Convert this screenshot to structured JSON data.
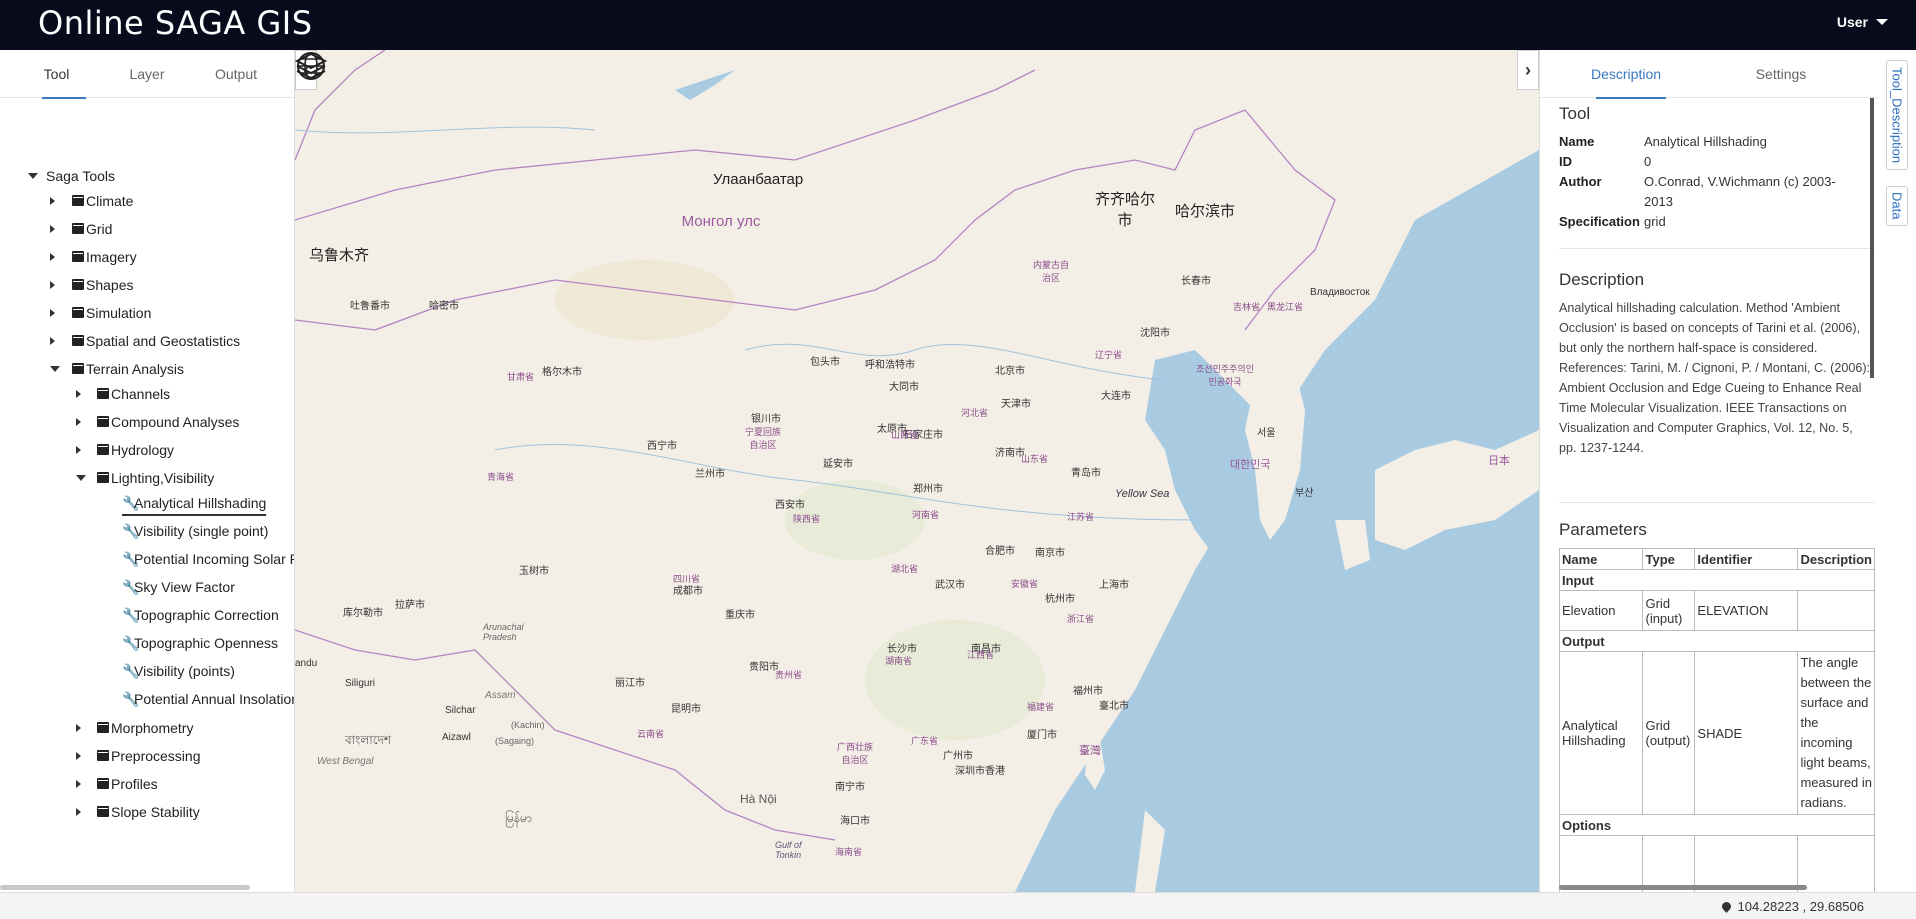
{
  "app": {
    "title": "Online SAGA GIS",
    "user_label": "User"
  },
  "left_panel": {
    "tabs": [
      {
        "label": "Tool"
      },
      {
        "label": "Layer"
      },
      {
        "label": "Output"
      }
    ],
    "tree": {
      "root": "Saga Tools",
      "categories": [
        {
          "label": "Climate"
        },
        {
          "label": "Grid"
        },
        {
          "label": "Imagery"
        },
        {
          "label": "Shapes"
        },
        {
          "label": "Simulation"
        },
        {
          "label": "Spatial and Geostatistics"
        },
        {
          "label": "Terrain Analysis"
        }
      ],
      "terrain_children": [
        {
          "label": "Channels"
        },
        {
          "label": "Compound Analyses"
        },
        {
          "label": "Hydrology"
        },
        {
          "label": "Lighting,Visibility"
        },
        {
          "label": "Morphometry"
        },
        {
          "label": "Preprocessing"
        },
        {
          "label": "Profiles"
        },
        {
          "label": "Slope Stability"
        }
      ],
      "lighting_tools": [
        {
          "label": "Analytical Hillshading"
        },
        {
          "label": "Visibility (single point)"
        },
        {
          "label": "Potential Incoming Solar Radiation"
        },
        {
          "label": "Sky View Factor"
        },
        {
          "label": "Topographic Correction"
        },
        {
          "label": "Topographic Openness"
        },
        {
          "label": "Visibility (points)"
        },
        {
          "label": "Potential Annual Insolation"
        }
      ]
    }
  },
  "map": {
    "labels": {
      "ulaanbaatar": "Улаанбаатар",
      "mongolia": "Монгол улс",
      "urumqi": "乌鲁木齐",
      "qiqihar": "齐齐哈尔市",
      "harbin": "哈尔滨市",
      "yellow_sea": "Yellow Sea",
      "south_korea": "대한민국",
      "north_korea": "조선민주주의인민공화국",
      "japan": "日本",
      "taiwan": "臺灣",
      "arunachal": "Arunachal Pradesh",
      "kachin": "(Kachin)",
      "sagaing": "(Sagaing)",
      "bangladesh": "বাংলাদেশ",
      "myanmar": "မြန်မာ",
      "hanoi": "Hà Nội",
      "hainan": "海南省",
      "gulf_tonkin": "Gulf of Tonkin",
      "beijing": "北京市",
      "tianjin": "天津市",
      "shanghai": "上海市",
      "wuhan": "武汉市",
      "chongqing": "重庆市",
      "chengdu": "成都市",
      "xian": "西安市",
      "guangzhou": "广州市",
      "nanning": "南宁市",
      "kunming": "昆明市",
      "guiyang": "贵阳市",
      "changsha": "长沙市",
      "nanchang": "南昌市",
      "fuzhou": "福州市",
      "hangzhou": "杭州市",
      "nanjing": "南京市",
      "hefei": "合肥市",
      "zhengzhou": "郑州市",
      "jinan": "济南市",
      "shijiazhuang": "石家庄市",
      "taiyuan": "太原市",
      "hohhot": "呼和浩特市",
      "lanzhou": "兰州市",
      "xining": "西宁市",
      "yinchuan": "银川市",
      "shenyang": "沈阳市",
      "changchun": "长春市",
      "dalian": "大连市",
      "qingdao": "青岛市",
      "seoul": "서울",
      "busan": "부산",
      "vladivostok": "Владивосток",
      "xiamen": "厦门市",
      "shenzhen": "深圳市",
      "hongkong": "香港",
      "taipei": "臺北市",
      "lhasa": "拉萨市",
      "haikou": "海口市",
      "lijiang": "丽江市",
      "baotou": "包头市",
      "datong": "大同市",
      "yanan": "延安市",
      "hami": "哈密市",
      "turpan": "吐鲁番市",
      "korla": "库尔勒市",
      "golmud": "格尔木市",
      "yushu": "玉树市",
      "qinghai": "青海省",
      "gansu": "甘肃省",
      "sichuan": "四川省",
      "yunnan": "云南省",
      "guangxi": "广西壮族自治区",
      "hunan": "湖南省",
      "hubei": "湖北省",
      "henan": "河南省",
      "shandong": "山东省",
      "shanxi": "山西省",
      "hebei": "河北省",
      "jiangxi": "江西省",
      "zhejiang": "浙江省",
      "jiangsu": "江苏省",
      "anhui": "安徽省",
      "fujian": "福建省",
      "guangdong": "广东省",
      "guizhou": "贵州省",
      "shaanxi": "陕西省",
      "ningxia": "宁夏回族自治区",
      "liaoning": "辽宁省",
      "jilin": "吉林省",
      "inner_mongolia": "内蒙古自治区",
      "heilongjiang": "黑龙江省",
      "siliguri": "Siliguri",
      "silchar": "Silchar",
      "aizawl": "Aizawl",
      "west_bengal": "West Bengal",
      "assam": "Assam",
      "nandu": "andu"
    }
  },
  "right_panel": {
    "tabs": [
      {
        "label": "Description"
      },
      {
        "label": "Settings"
      }
    ],
    "tool": {
      "title": "Tool",
      "fields": [
        {
          "key": "Name",
          "value": "Analytical Hillshading"
        },
        {
          "key": "ID",
          "value": "0"
        },
        {
          "key": "Author",
          "value": "O.Conrad, V.Wichmann (c) 2003-2013"
        },
        {
          "key": "Specification",
          "value": "grid"
        }
      ]
    },
    "description": {
      "title": "Description",
      "text": "Analytical hillshading calculation. Method 'Ambient Occlusion' is based on concepts of Tarini et al. (2006), but only the northern half-space is considered. References: Tarini, M. / Cignoni, P. / Montani, C. (2006): Ambient Occlusion and Edge Cueing to Enhance Real Time Molecular Visualization. IEEE Transactions on Visualization and Computer Graphics, Vol. 12, No. 5, pp. 1237-1244."
    },
    "parameters": {
      "title": "Parameters",
      "columns": [
        "Name",
        "Type",
        "Identifier",
        "Description"
      ],
      "groups": {
        "input": "Input",
        "output": "Output",
        "options": "Options"
      },
      "input_row": {
        "name": "Elevation",
        "type": "Grid (input)",
        "identifier": "ELEVATION",
        "description": ""
      },
      "output_row": {
        "name": "Analytical Hillshading",
        "type": "Grid (output)",
        "identifier": "SHADE",
        "description": "The angle between the surface and the incoming light beams, measured in radians."
      }
    }
  },
  "side_tabs": [
    {
      "label": "Tool_Description"
    },
    {
      "label": "Data"
    }
  ],
  "status": {
    "coordinates": "104.28223 , 29.68506"
  },
  "colors": {
    "header_bg": "#070b1c",
    "accent": "#3a78c3",
    "water": "#a9cbe1",
    "land": "#f3efe6"
  }
}
